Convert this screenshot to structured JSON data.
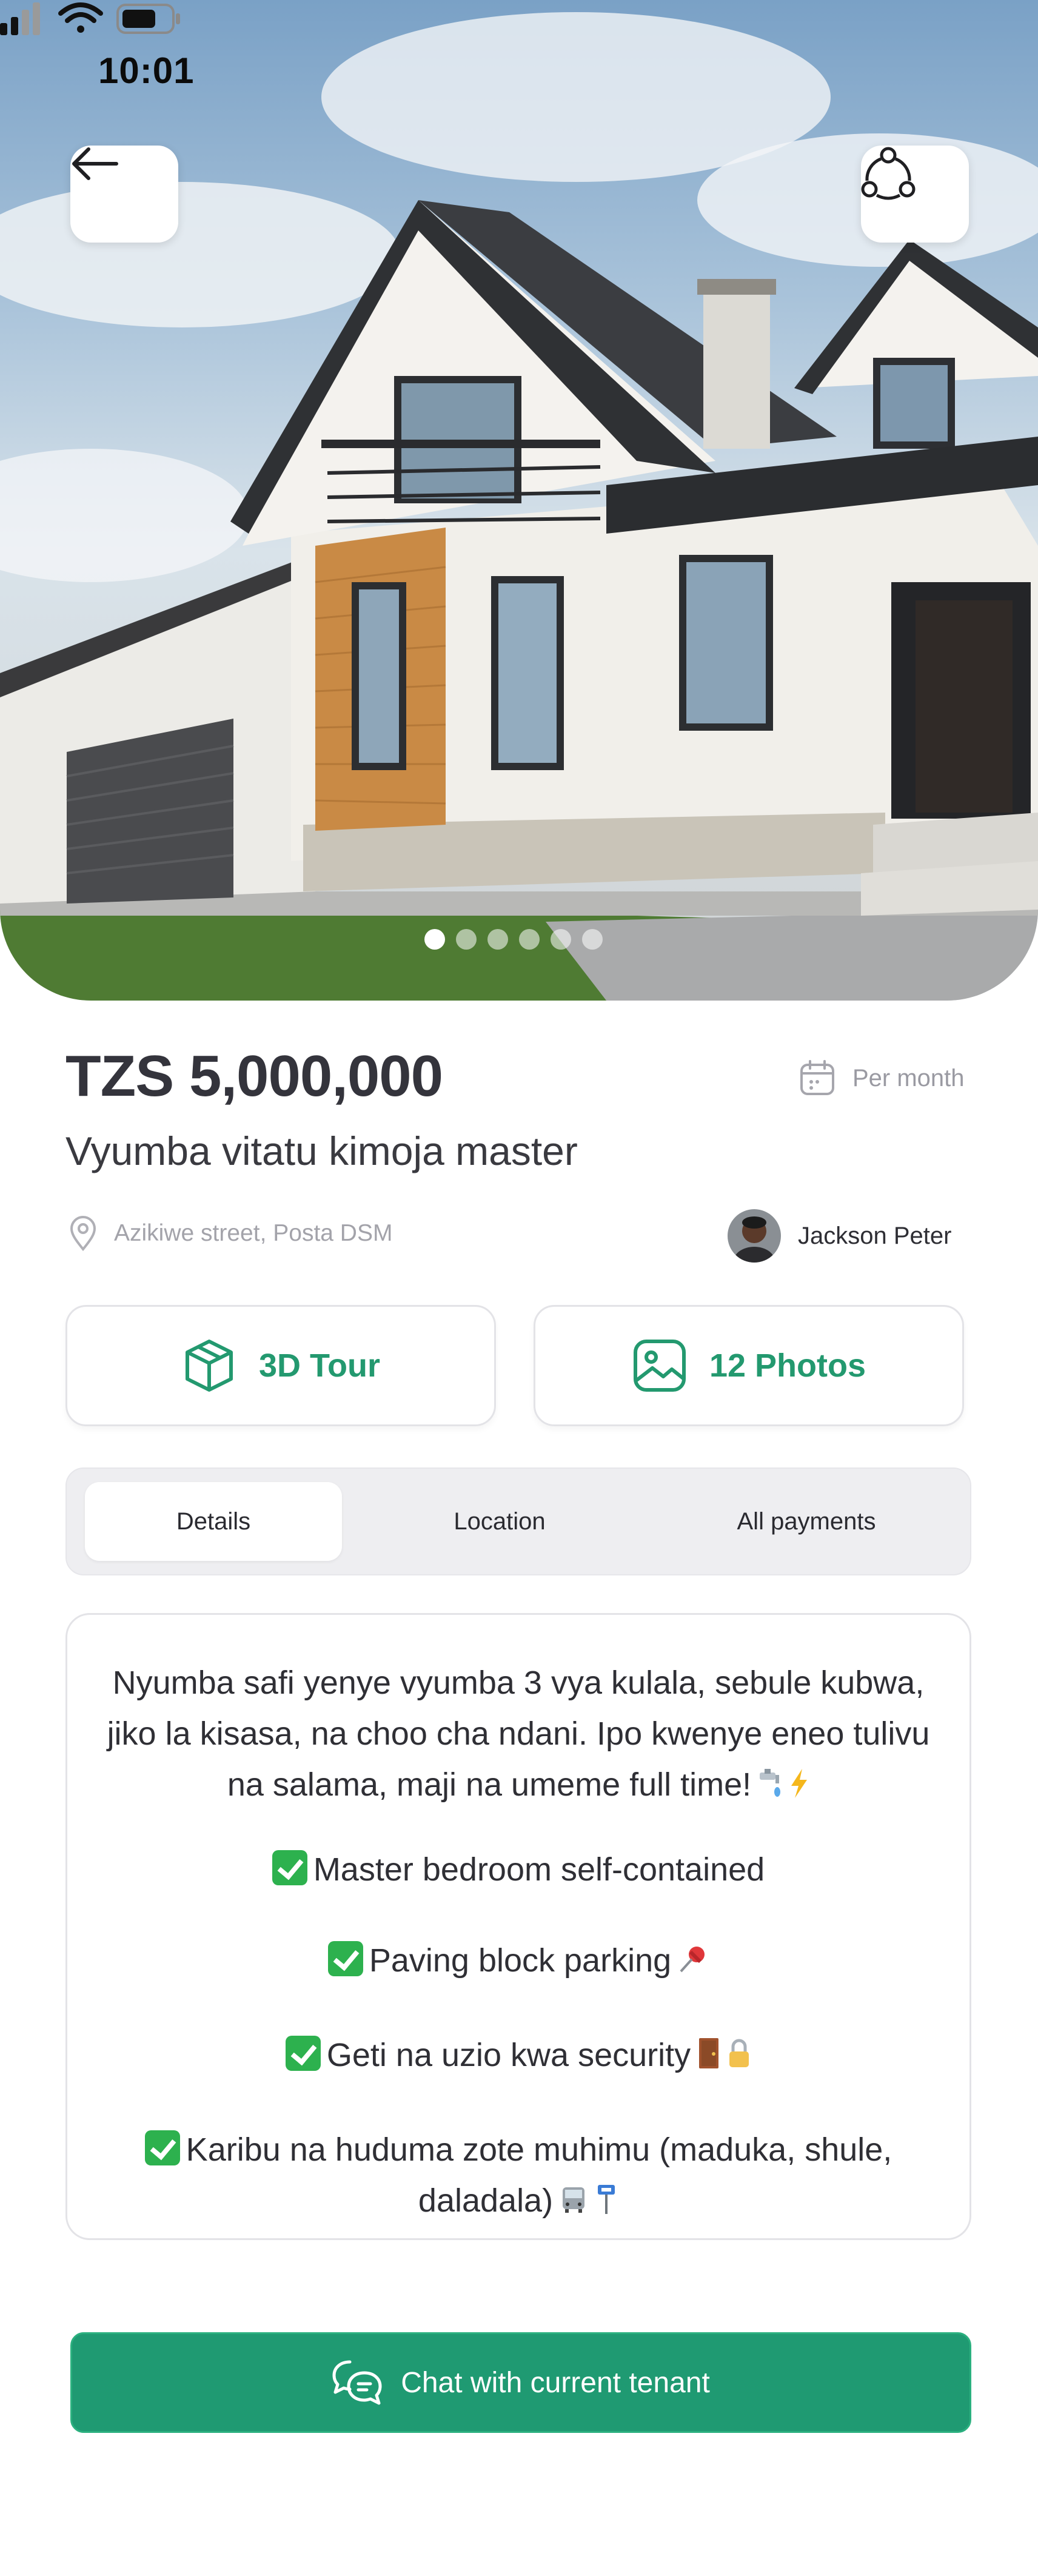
{
  "status_bar": {
    "time": "10:01"
  },
  "carousel": {
    "total": 6,
    "active_index": 0
  },
  "listing": {
    "price": "TZS 5,000,000",
    "period": "Per month",
    "title": "Vyumba vitatu kimoja master",
    "location": "Azikiwe street, Posta DSM",
    "owner_name": "Jackson Peter"
  },
  "media": {
    "tour_label": "3D Tour",
    "photos_label": "12 Photos"
  },
  "tabs": [
    {
      "label": "Details",
      "active": true
    },
    {
      "label": "Location",
      "active": false
    },
    {
      "label": "All payments",
      "active": false
    }
  ],
  "description": {
    "intro": "Nyumba safi yenye vyumba 3 vya kulala, sebule kubwa, jiko la kisasa, na choo cha ndani. Ipo kwenye eneo tulivu na salama, maji na umeme full time!",
    "features": [
      "Master bedroom self-contained",
      "Paving block parking",
      "Geti na uzio kwa security",
      "Karibu na huduma zote muhimu (maduka, shule, daladala)"
    ]
  },
  "chat": {
    "label": "Chat with current tenant"
  },
  "colors": {
    "accent": "#1f9a72",
    "check": "#2db14e",
    "text": "#34343c",
    "muted": "#9a9aa2"
  }
}
